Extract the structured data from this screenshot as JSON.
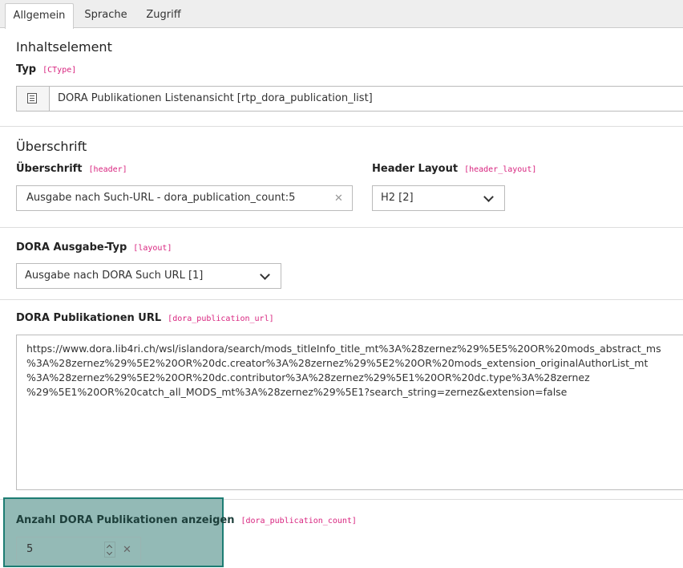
{
  "tabs": [
    {
      "label": "Allgemein",
      "active": true
    },
    {
      "label": "Sprache",
      "active": false
    },
    {
      "label": "Zugriff",
      "active": false
    }
  ],
  "content_element": {
    "section_title": "Inhaltselement",
    "type_label": "Typ",
    "type_code": "[CType]",
    "type_value": "DORA Publikationen Listenansicht [rtp_dora_publication_list]",
    "type_icon": "content-element-icon"
  },
  "header_section": {
    "section_title": "Überschrift",
    "header_label": "Überschrift",
    "header_code": "[header]",
    "header_value": "Ausgabe nach Such-URL - dora_publication_count:5",
    "layout_label": "Header Layout",
    "layout_code": "[header_layout]",
    "layout_value": "H2 [2]"
  },
  "output_type": {
    "label": "DORA Ausgabe-Typ",
    "code": "[layout]",
    "value": "Ausgabe nach DORA Such URL [1]"
  },
  "publication_url": {
    "label": "DORA Publikationen URL",
    "code": "[dora_publication_url]",
    "lines": [
      "https://www.dora.lib4ri.ch/wsl/islandora/search/mods_titleInfo_title_mt%3A%28zernez%29%5E5%20OR%20mods_abstract_ms",
      "%3A%28zernez%29%5E2%20OR%20dc.creator%3A%28zernez%29%5E2%20OR%20mods_extension_originalAuthorList_mt",
      "%3A%28zernez%29%5E2%20OR%20dc.contributor%3A%28zernez%29%5E1%20OR%20dc.type%3A%28zernez",
      "%29%5E1%20OR%20catch_all_MODS_mt%3A%28zernez%29%5E1?search_string=zernez&extension=false"
    ]
  },
  "publication_count": {
    "label": "Anzahl DORA Publikationen anzeigen",
    "code": "[dora_publication_count]",
    "value": "5"
  },
  "colors": {
    "field_code": "#d8247f",
    "highlight_fill": "#93bab6",
    "highlight_border": "#1d7d73"
  }
}
